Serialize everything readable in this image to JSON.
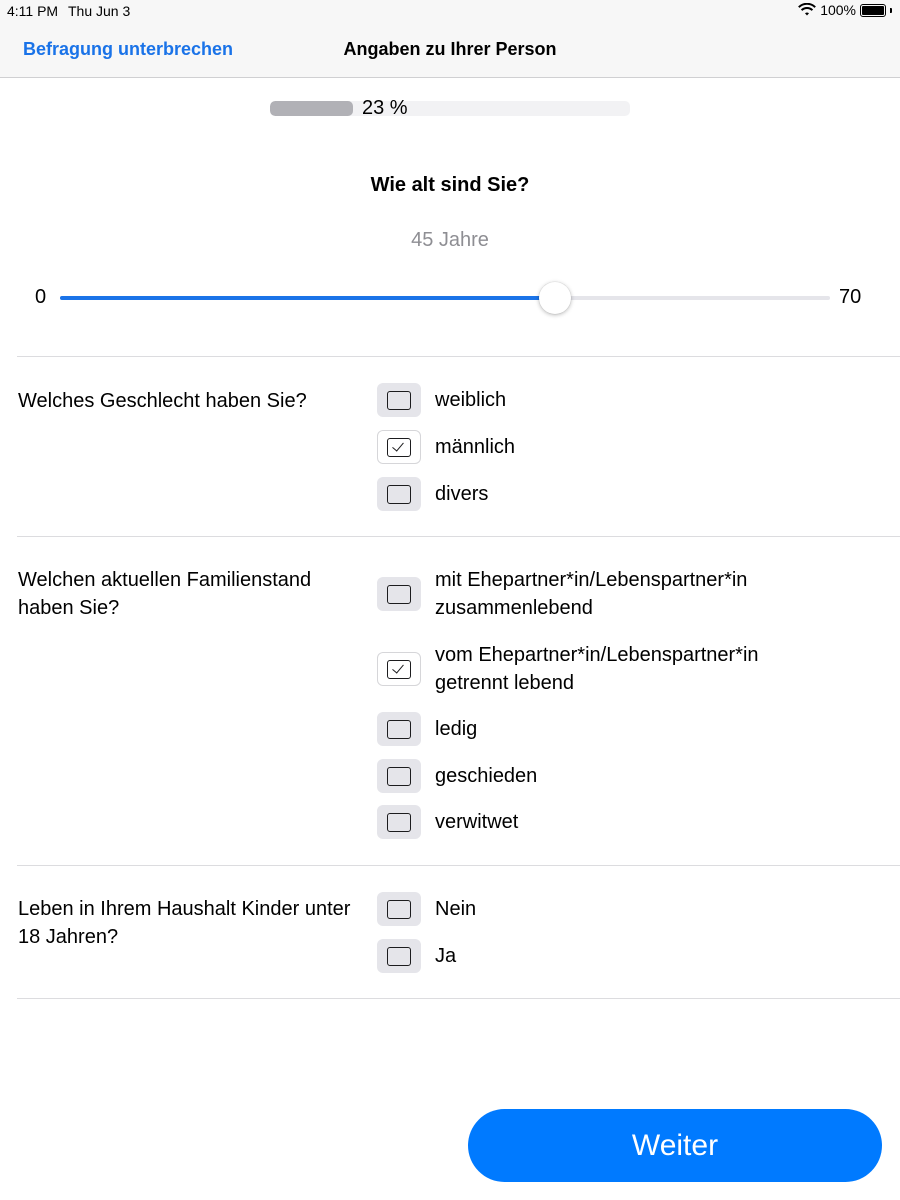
{
  "status_bar": {
    "time": "4:11 PM",
    "date": "Thu Jun 3",
    "battery": "100%"
  },
  "nav": {
    "back_label": "Befragung unterbrechen",
    "title": "Angaben zu Ihrer Person"
  },
  "progress": {
    "label": "23 %",
    "value": 0.23
  },
  "age": {
    "question": "Wie alt sind Sie?",
    "value_label": "45 Jahre",
    "min_label": "0",
    "max_label": "70",
    "value": 45,
    "min": 0,
    "max": 70
  },
  "questions": [
    {
      "label": "Welches Geschlecht haben Sie?",
      "options": [
        {
          "label": "weiblich",
          "checked": false
        },
        {
          "label": "männlich",
          "checked": true
        },
        {
          "label": "divers",
          "checked": false
        }
      ]
    },
    {
      "label": "Welchen aktuellen Familienstand haben Sie?",
      "options": [
        {
          "label": "mit Ehepartner*in/Lebenspartner*in zusammenlebend",
          "checked": false
        },
        {
          "label": "vom Ehepartner*in/Lebenspartner*in getrennt lebend",
          "checked": true
        },
        {
          "label": "ledig",
          "checked": false
        },
        {
          "label": "geschieden",
          "checked": false
        },
        {
          "label": "verwitwet",
          "checked": false
        }
      ]
    },
    {
      "label": "Leben in Ihrem Haushalt Kinder unter 18 Jahren?",
      "options": [
        {
          "label": "Nein",
          "checked": false
        },
        {
          "label": "Ja",
          "checked": false
        }
      ]
    }
  ],
  "next_button": {
    "label": "Weiter"
  },
  "colors": {
    "accent": "#1a73e8",
    "button": "#007aff"
  }
}
